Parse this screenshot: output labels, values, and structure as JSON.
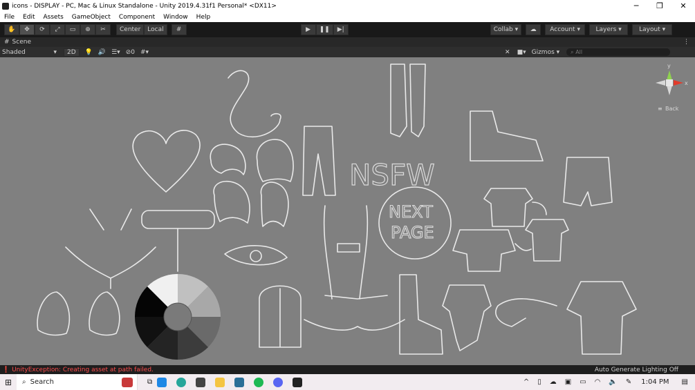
{
  "window": {
    "title": "icons - DISPLAY - PC, Mac & Linux Standalone - Unity 2019.4.31f1 Personal* <DX11>",
    "minimize": "─",
    "maximize": "❐",
    "close": "✕"
  },
  "menu": [
    "File",
    "Edit",
    "Assets",
    "GameObject",
    "Component",
    "Window",
    "Help"
  ],
  "toolbar": {
    "pivot": "Center",
    "space": "Local",
    "collab": "Collab ▾",
    "account": "Account",
    "layers": "Layers",
    "layout": "Layout"
  },
  "scene": {
    "tab": "Scene",
    "shading": "Shaded",
    "mode2d": "2D",
    "hidden_count": "0",
    "gizmos": "Gizmos",
    "search_placeholder": "All"
  },
  "gizmo": {
    "y": "y",
    "x": "x",
    "back": "Back"
  },
  "canvas_text": {
    "nsfw": "NSFW",
    "next": "NEXT",
    "page": "PAGE"
  },
  "status": {
    "error": "UnityException: Creating asset at path  failed.",
    "lighting": "Auto Generate Lighting Off"
  },
  "taskbar": {
    "search": "Search",
    "time": "1:04 PM"
  },
  "colors": {
    "error": "#ff4d4d",
    "gizmo_y": "#8fd14f",
    "gizmo_x": "#e23b2b",
    "sketch": "#e9e9e9"
  }
}
